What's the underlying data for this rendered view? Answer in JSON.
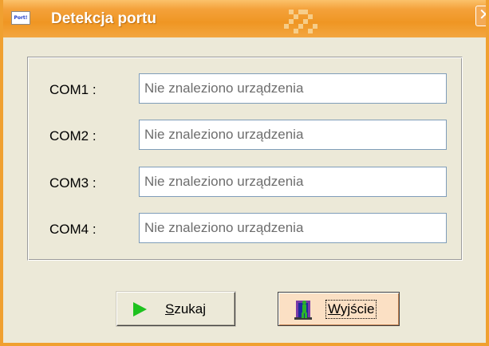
{
  "window": {
    "title": "Detekcja portu",
    "icon_text": "Port!",
    "close_glyph": "✕",
    "accent_color": "#f0a030",
    "title_text_color": "#ffffff"
  },
  "ports": [
    {
      "label": "COM1 :",
      "value": "Nie znaleziono urządzenia"
    },
    {
      "label": "COM2 :",
      "value": "Nie znaleziono urządzenia"
    },
    {
      "label": "COM3 :",
      "value": "Nie znaleziono urządzenia"
    },
    {
      "label": "COM4 :",
      "value": "Nie znaleziono urządzenia"
    }
  ],
  "buttons": {
    "search": {
      "label_underlined": "S",
      "label_rest": "zukaj",
      "icon": "play-icon",
      "icon_color": "#1ec21e"
    },
    "exit": {
      "label_underlined": "W",
      "label_rest": "yjście",
      "icon": "exit-door-icon"
    }
  }
}
